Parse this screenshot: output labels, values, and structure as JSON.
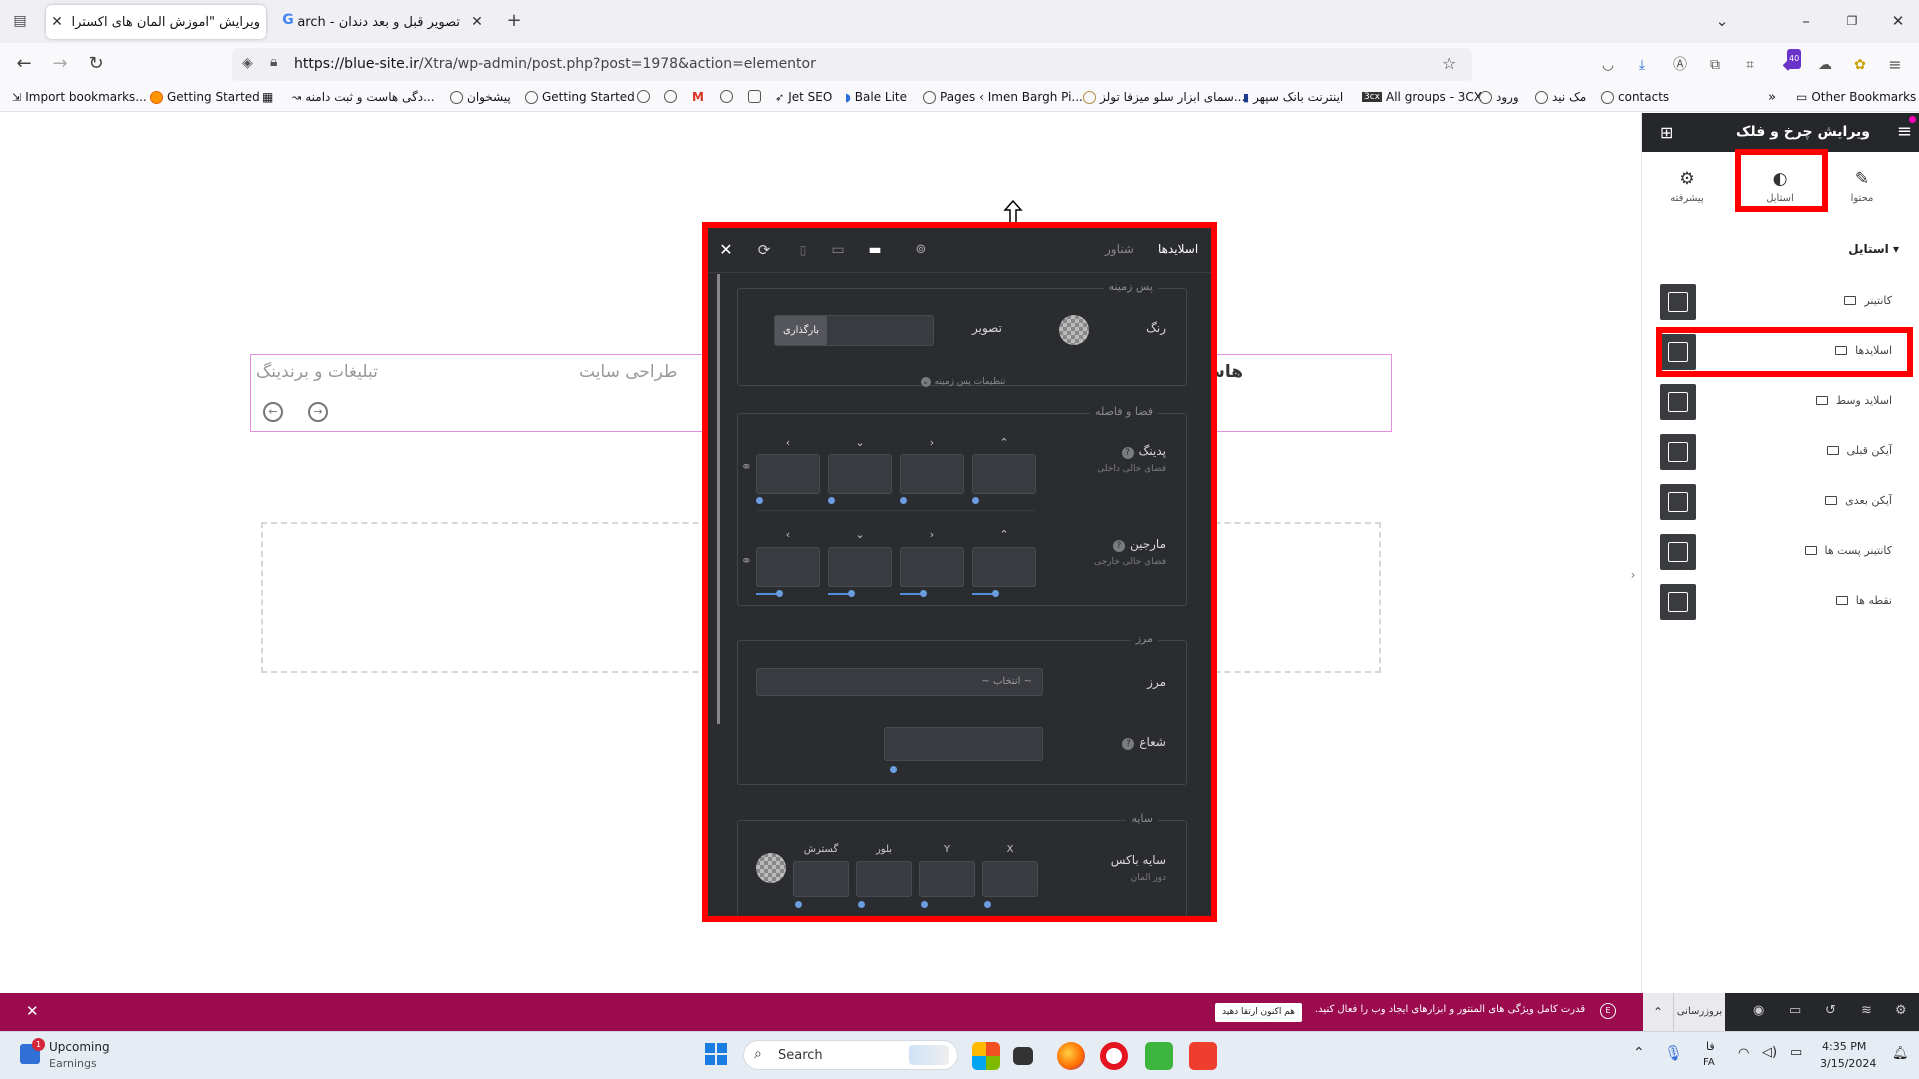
{
  "browser": {
    "tabs": [
      {
        "title": "ویرایش \"آموزش المان های اکسترا – ها",
        "active": true
      },
      {
        "title": "تصویر قبل و بعد دندان - Search",
        "active": false
      }
    ],
    "url": "https://blue-site.ir/Xtra/wp-admin/post.php?post=1978&action=elementor",
    "url_domain": "https://blue-site.ir",
    "url_path": "/Xtra/wp-admin/post.php?post=1978&action=elementor",
    "badge_count": "40",
    "bookmarks": [
      "Import bookmarks...",
      "Getting Started",
      "دگی هاست و ثبت دامنه...",
      "پیشخوان",
      "Getting Started",
      "Jet SEO",
      "Bale Lite",
      "Pages ‹ Imen Bargh Pi...",
      "سمای ابزار سلو میزفا تولز...",
      "اینترنت بانک سپهر",
      "All groups - 3CX",
      "ورود",
      "مک نید",
      "contacts"
    ],
    "other_bookmarks": "Other Bookmarks"
  },
  "page": {
    "menu_items": [
      "هاس",
      "طراحی سایت",
      "تبلیغات و برندینگ"
    ]
  },
  "popup": {
    "header": {
      "tab_active": "اسلایدها",
      "tab_inactive": "شناور"
    },
    "background": {
      "title": "پس زمینه",
      "color_label": "رنگ",
      "image_label": "تصویر",
      "upload_button": "بارگذاری",
      "more_settings": "تنظیمات پس زمینه"
    },
    "spacing": {
      "title": "فضا و فاصله",
      "padding_label": "پدینگ",
      "padding_sub": "فضای خالی داخلی",
      "margin_label": "مارجین",
      "margin_sub": "فضای خالی خارجی"
    },
    "border": {
      "title": "مرز",
      "border_label": "مرز",
      "select_placeholder": "~ انتخاب ~",
      "radius_label": "شعاع"
    },
    "shadow": {
      "title": "سایه",
      "box_shadow_label": "سایه باکس",
      "box_shadow_sub": "دور المان",
      "columns": [
        "گسترش",
        "بلور",
        "Y",
        "X"
      ]
    }
  },
  "sidebar": {
    "title": "ویرایش چرخ و فلک",
    "tabs": [
      {
        "label": "محتوا",
        "icon": "pencil-icon"
      },
      {
        "label": "استایل",
        "icon": "contrast-icon",
        "active": true
      },
      {
        "label": "پیشرفته",
        "icon": "gear-icon"
      }
    ],
    "section_title": "استایل",
    "items": [
      {
        "label": "کانتینر"
      },
      {
        "label": "اسلایدها",
        "highlighted": true
      },
      {
        "label": "اسلاید وسط"
      },
      {
        "label": "آیکن قبلی"
      },
      {
        "label": "آیکن بعدی"
      },
      {
        "label": "کانتینر پست ها"
      },
      {
        "label": "نقطه ها"
      }
    ]
  },
  "notification": {
    "message": "قدرت کامل ویژگی های المنتور و ابزارهای ایجاد وب را فعال کنید.",
    "button": "هم اکنون ارتقا دهید",
    "update_button": "بروزرسانی"
  },
  "taskbar": {
    "widget_title": "Upcoming",
    "widget_sub": "Earnings",
    "widget_badge": "1",
    "search_placeholder": "Search",
    "lang_top": "فا",
    "lang_bottom": "FA",
    "time": "4:35 PM",
    "date": "3/15/2024"
  },
  "colors": {
    "highlight_red": "#ff0000",
    "editor_dark": "#2b2c30",
    "notification_bg": "#9b0b4d",
    "selection_pink": "#e58fde"
  }
}
